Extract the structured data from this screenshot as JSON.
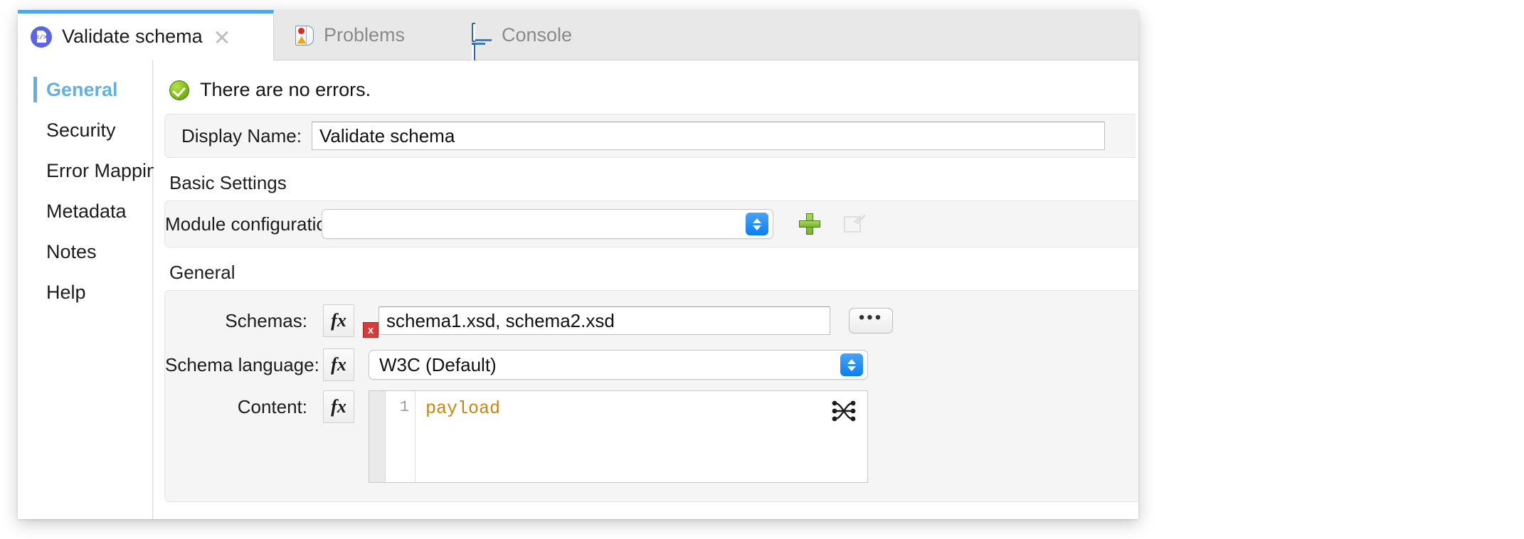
{
  "window": {
    "tabs": [
      {
        "id": "validate-schema",
        "label": "Validate schema",
        "icon": "document-code-icon",
        "active": true,
        "closable": true
      },
      {
        "id": "problems",
        "label": "Problems",
        "icon": "problems-icon",
        "active": false,
        "closable": false
      },
      {
        "id": "console",
        "label": "Console",
        "icon": "console-monitor-icon",
        "active": false,
        "closable": false
      }
    ]
  },
  "sidebar": {
    "items": [
      {
        "label": "General",
        "active": true
      },
      {
        "label": "Security",
        "active": false
      },
      {
        "label": "Error Mapping",
        "active": false
      },
      {
        "label": "Metadata",
        "active": false
      },
      {
        "label": "Notes",
        "active": false
      },
      {
        "label": "Help",
        "active": false
      }
    ]
  },
  "status": {
    "icon": "success-check-icon",
    "text": "There are no errors.",
    "color": "#7cb916"
  },
  "display_name": {
    "label": "Display Name:",
    "value": "Validate schema",
    "placeholder": ""
  },
  "basic_settings": {
    "title": "Basic Settings",
    "module_configuration": {
      "label": "Module configuration:",
      "value": "",
      "placeholder": "",
      "add_icon": "plus-icon",
      "edit_icon": "edit-pencil-icon"
    }
  },
  "general": {
    "title": "General",
    "schemas": {
      "label": "Schemas:",
      "fx_label": "fx",
      "value": "schema1.xsd, schema2.xsd",
      "error_badge": "x",
      "browse_label": "•••"
    },
    "schema_language": {
      "label": "Schema language:",
      "fx_label": "fx",
      "value": "W3C (Default)",
      "options": [
        "W3C (Default)"
      ]
    },
    "content": {
      "label": "Content:",
      "fx_label": "fx",
      "line_number": "1",
      "code": "payload",
      "code_color": "#c8860d",
      "transform_icon": "dataweave-transform-icon"
    }
  }
}
